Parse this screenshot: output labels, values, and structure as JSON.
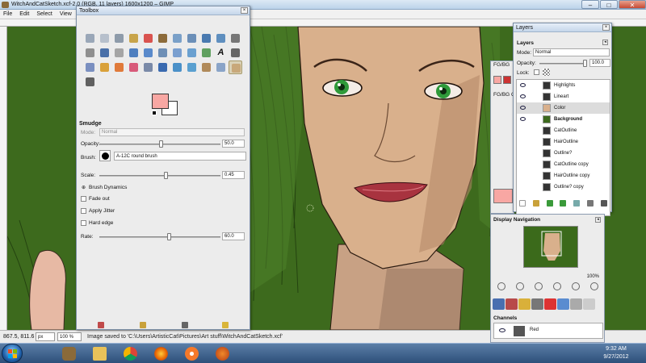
{
  "window": {
    "title": "WitchAndCatSketch.xcf-2.0 (RGB, 11 layers) 1600x1200 – GIMP",
    "minimize": "–",
    "maximize": "□",
    "close": "✕"
  },
  "menu": [
    "File",
    "Edit",
    "Select",
    "View"
  ],
  "status": {
    "coords": "867.5, 811.6",
    "unit": "px",
    "zoom": "100 %",
    "message": "Image saved to 'C:\\Users\\ArtisticCat\\Pictures\\Art stuff\\WitchAndCatSketch.xcf'"
  },
  "toolbox": {
    "title": "Toolbox",
    "tool_icons": [
      "rect-select-icon",
      "ellipse-select-icon",
      "free-select-icon",
      "fuzzy-select-icon",
      "color-select-icon",
      "scissors-icon",
      "foreground-select-icon",
      "paths-icon",
      "color-picker-icon",
      "zoom-icon",
      "measure-icon",
      "move-icon",
      "align-icon",
      "crop-icon",
      "rotate-icon",
      "scale-icon",
      "shear-icon",
      "perspective-icon",
      "flip-icon",
      "cage-icon",
      "text-icon",
      "bucket-fill-icon",
      "blend-icon",
      "pencil-icon",
      "paintbrush-icon",
      "eraser-icon",
      "airbrush-icon",
      "ink-icon",
      "clone-icon",
      "heal-icon",
      "perspective-clone-icon",
      "blur-icon",
      "smudge-icon",
      "dodge-burn-icon"
    ],
    "fg_color": "#f8a7a3",
    "bg_color": "#ffffff",
    "options": {
      "section": "Smudge",
      "mode_label": "Mode:",
      "mode_value": "Normal",
      "opacity_label": "Opacity:",
      "opacity_value": "50.0",
      "brush_label": "Brush:",
      "brush_value": "A-12C round brush",
      "scale_label": "Scale:",
      "scale_value": "0.45",
      "dynamics_label": "Brush Dynamics",
      "fade_label": "Fade out",
      "jitter_label": "Apply Jitter",
      "hard_edge_label": "Hard edge",
      "rate_label": "Rate:",
      "rate_value": "60.0"
    }
  },
  "fgbg_dock": {
    "tab_label": "FG/BG",
    "label": "FG/BG C"
  },
  "layers": {
    "title": "Layers",
    "section": "Layers",
    "mode_label": "Mode:",
    "mode_value": "Normal",
    "opacity_label": "Opacity:",
    "opacity_value": "100.0",
    "lock_label": "Lock:",
    "items": [
      {
        "name": "Highlights",
        "visible": true
      },
      {
        "name": "Lineart",
        "visible": true
      },
      {
        "name": "Color",
        "visible": true
      },
      {
        "name": "Background",
        "visible": true
      },
      {
        "name": "CatOutline",
        "visible": false
      },
      {
        "name": "HairOutline",
        "visible": false
      },
      {
        "name": "Outline?",
        "visible": false
      },
      {
        "name": "CatOutline copy",
        "visible": false
      },
      {
        "name": "HairOutline copy",
        "visible": false
      },
      {
        "name": "Outline? copy",
        "visible": false
      }
    ]
  },
  "navigation": {
    "title": "Display Navigation",
    "zoom_value": "100%"
  },
  "channels": {
    "title": "Channels",
    "row_name": "Red"
  },
  "clock": {
    "time": "9:32 AM",
    "date": "9/27/2012"
  },
  "colors": {
    "canvas_green": "#3d6a1d",
    "skin": "#d9b08c",
    "lips": "#a8333f",
    "eyes": "#2f9a3a"
  }
}
